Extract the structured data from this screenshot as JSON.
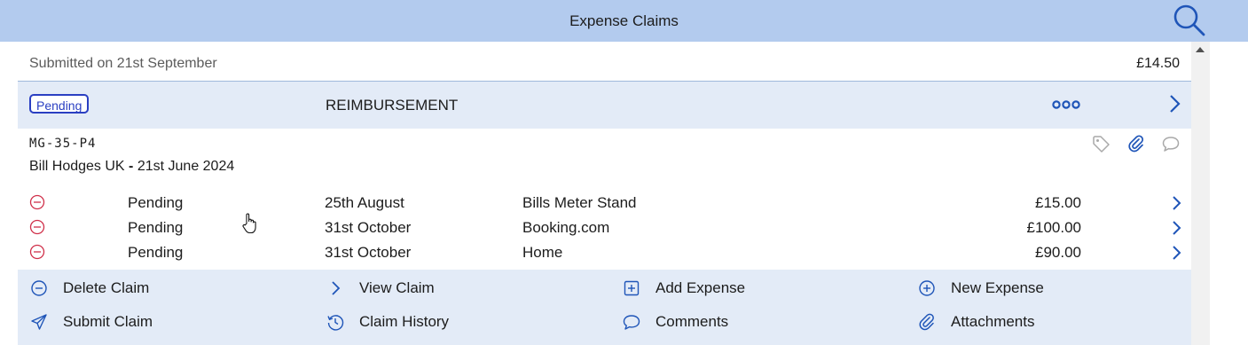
{
  "header": {
    "title": "Expense Claims",
    "search_icon": "search-icon"
  },
  "previous_claim": {
    "cut_text": "",
    "submitted": "Submitted on 21st September",
    "amount": "£14.50"
  },
  "claim": {
    "status_badge": "Pending",
    "type": "REIMBURSEMENT",
    "reference": "MG-35-P4",
    "name_prefix": "Bill Hodges UK",
    "name_separator": " - ",
    "name_date": "21st June 2024",
    "icons": [
      "tag-icon",
      "paperclip-icon",
      "comment-icon"
    ],
    "colors": {
      "badge": "#2a3fc2",
      "accent": "#1f55b8",
      "remove": "#d0304a"
    }
  },
  "expenses": [
    {
      "status": "Pending",
      "date": "25th August",
      "description": "Bills Meter Stand",
      "amount": "£15.00"
    },
    {
      "status": "Pending",
      "date": "31st October",
      "description": "Booking.com",
      "amount": "£100.00"
    },
    {
      "status": "Pending",
      "date": "31st October",
      "description": "Home",
      "amount": "£90.00"
    }
  ],
  "actions": [
    {
      "label": "Delete Claim",
      "icon": "minus-circle-icon"
    },
    {
      "label": "View Claim",
      "icon": "chevron-right-icon"
    },
    {
      "label": "Add Expense",
      "icon": "plus-square-icon"
    },
    {
      "label": "New Expense",
      "icon": "plus-circle-icon"
    },
    {
      "label": "Submit Claim",
      "icon": "send-icon"
    },
    {
      "label": "Claim History",
      "icon": "history-icon"
    },
    {
      "label": "Comments",
      "icon": "comment-icon"
    },
    {
      "label": "Attachments",
      "icon": "paperclip-icon"
    }
  ]
}
